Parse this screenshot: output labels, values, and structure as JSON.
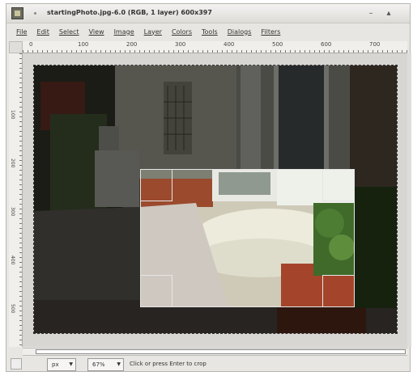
{
  "window": {
    "title": "startingPhoto.jpg-6.0 (RGB, 1 layer) 600x397"
  },
  "icons": {
    "app": "gimp-wilber-icon",
    "minimize": "minimize-icon",
    "maximize": "maximize-icon"
  },
  "menu": {
    "items": [
      {
        "label": "File"
      },
      {
        "label": "Edit"
      },
      {
        "label": "Select"
      },
      {
        "label": "View"
      },
      {
        "label": "Image"
      },
      {
        "label": "Layer"
      },
      {
        "label": "Colors"
      },
      {
        "label": "Tools"
      },
      {
        "label": "Dialogs"
      },
      {
        "label": "Filters"
      }
    ]
  },
  "ruler": {
    "top_labels": [
      "0",
      "100",
      "200",
      "300",
      "400",
      "500",
      "600",
      "700"
    ],
    "left_labels": [
      "100",
      "200",
      "300",
      "400",
      "500"
    ]
  },
  "statusbar": {
    "unit": "px",
    "zoom": "67%",
    "message": "Click or press Enter to crop"
  },
  "colors": {
    "window_bg": "#e8e6e2",
    "crop_guide": "#e8e8e8"
  }
}
